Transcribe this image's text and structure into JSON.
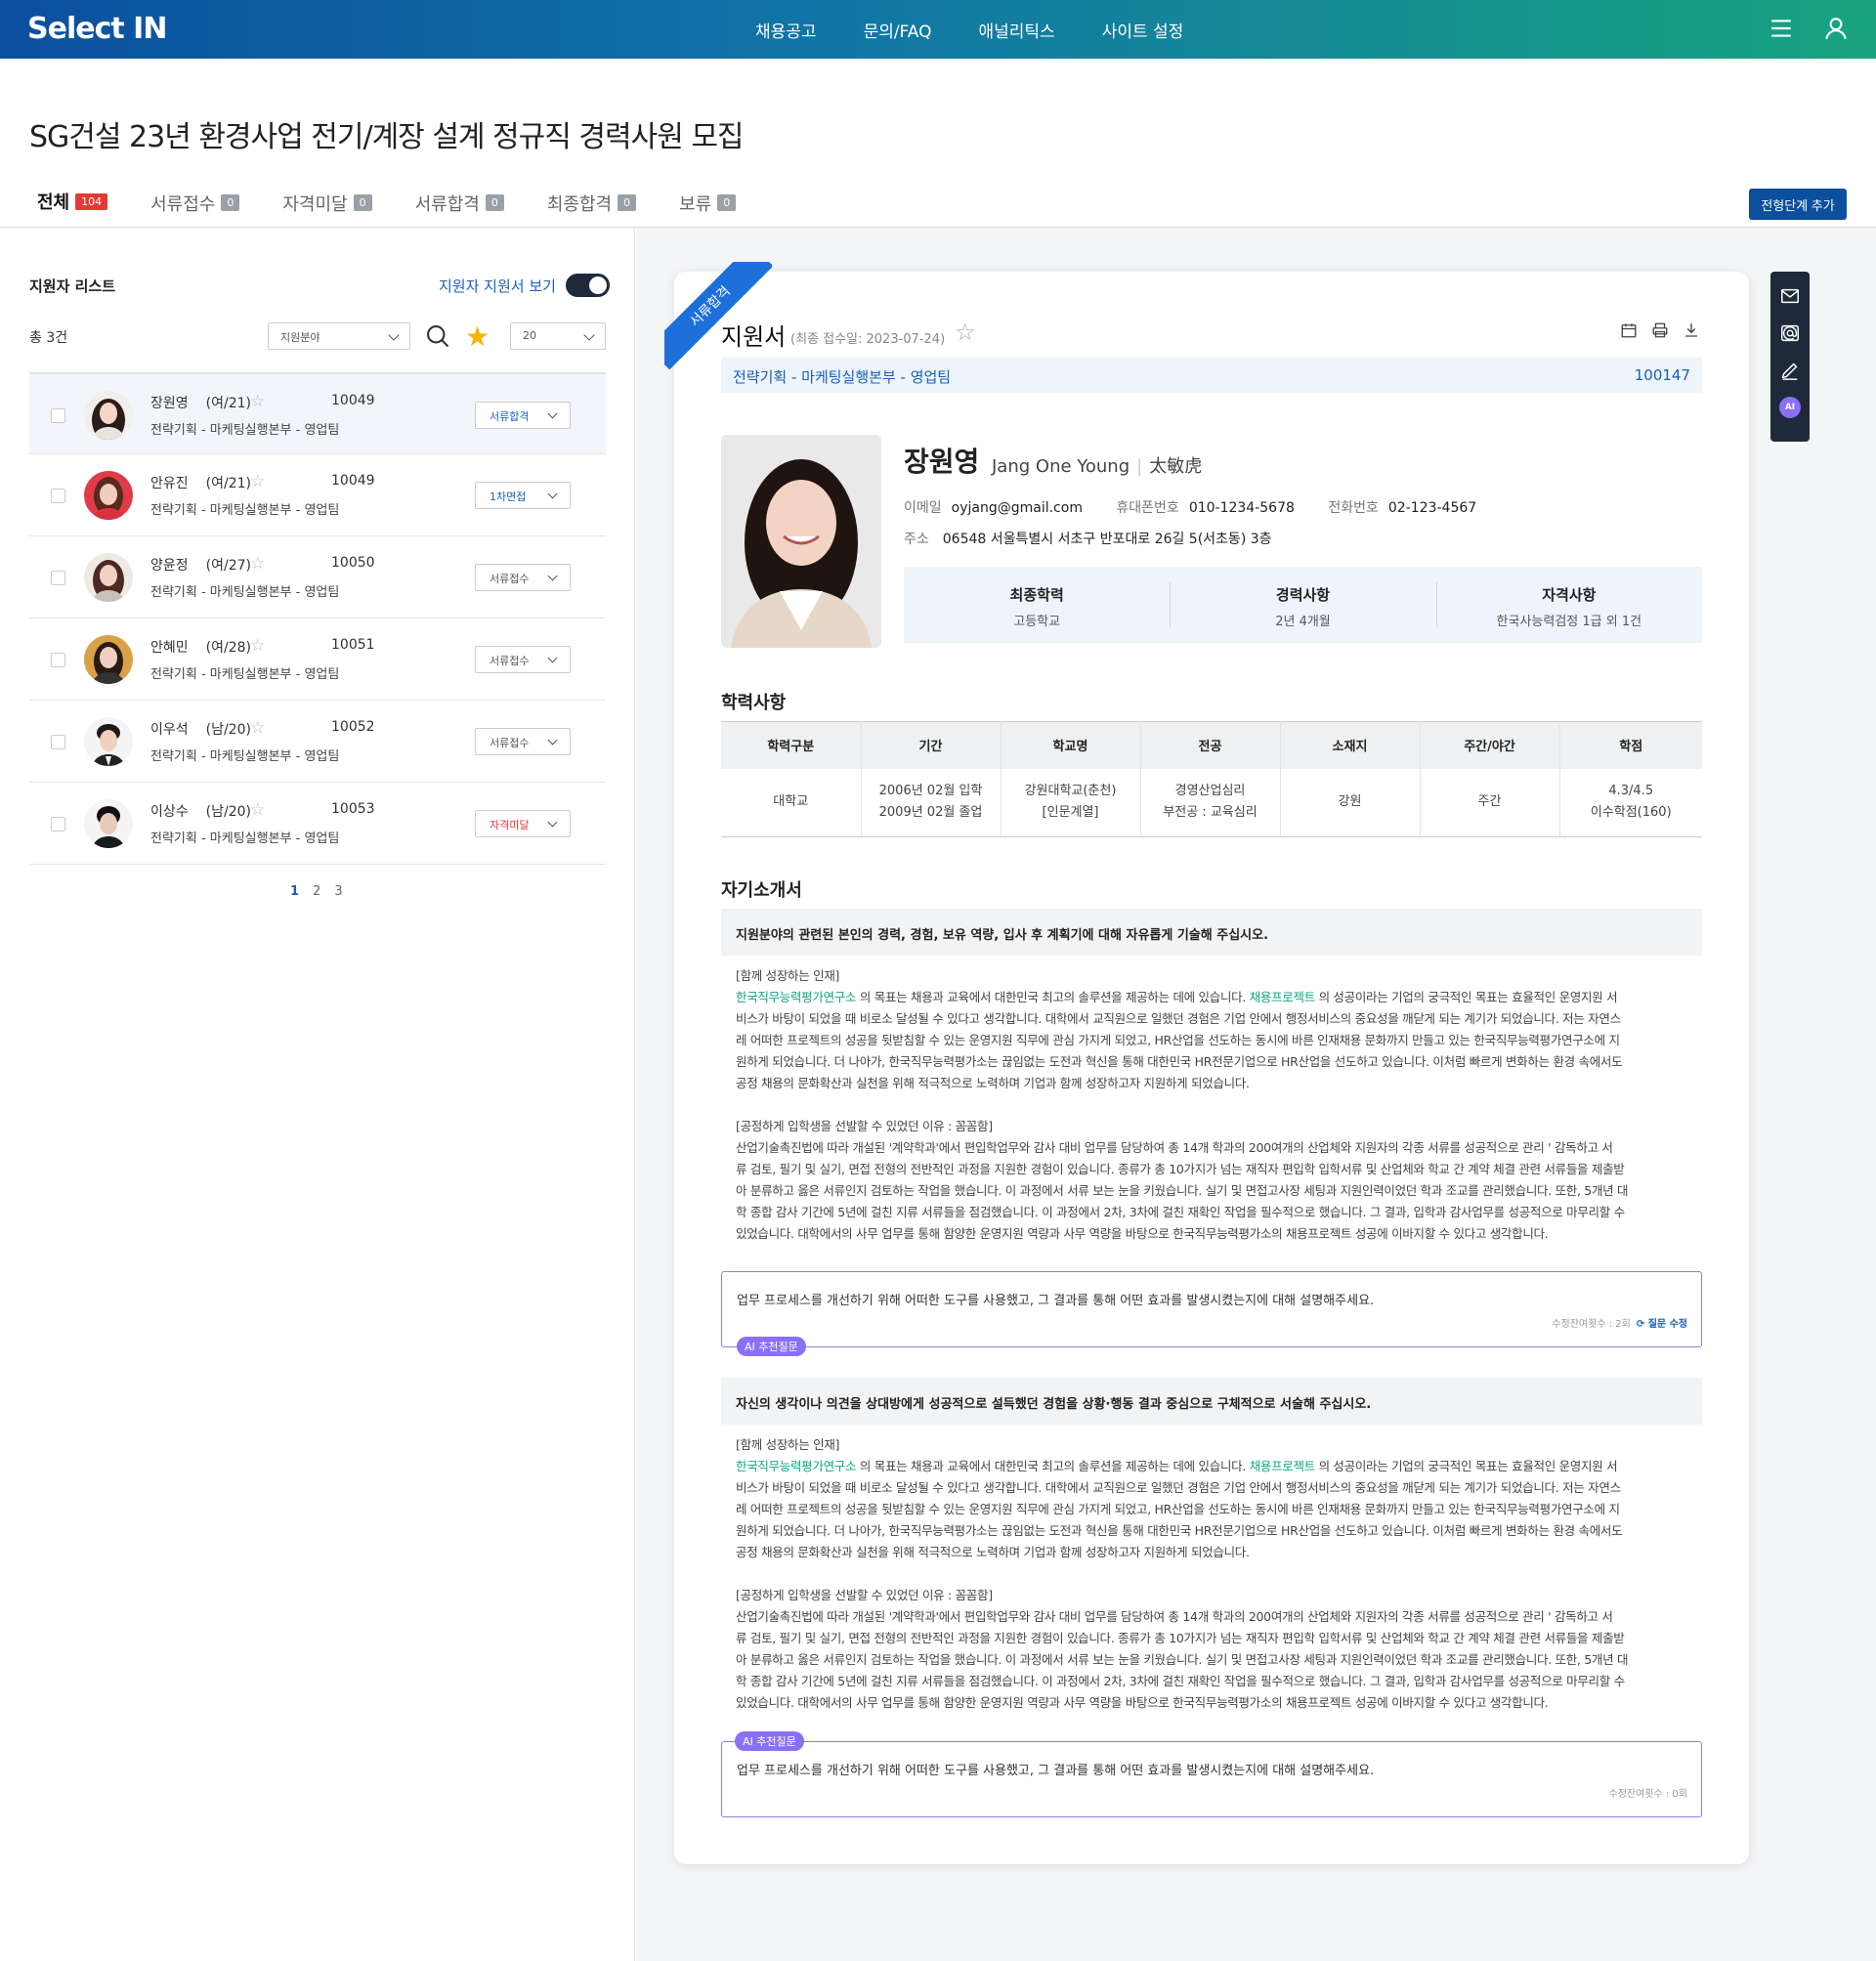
{
  "header": {
    "logo": "Select IN",
    "nav": [
      "채용공고",
      "문의/FAQ",
      "애널리틱스",
      "사이트 설정"
    ],
    "menu_icon": "menu-icon",
    "user_icon": "user-icon"
  },
  "page": {
    "title": "SG건설 23년 환경사업 전기/계장 설계 정규직 경력사원 모집",
    "add_step_button": "전형단계 추가"
  },
  "tabs": [
    {
      "label": "전체",
      "count": "104"
    },
    {
      "label": "서류접수",
      "count": "0"
    },
    {
      "label": "자격미달",
      "count": "0"
    },
    {
      "label": "서류합격",
      "count": "0"
    },
    {
      "label": "최종합격",
      "count": "0"
    },
    {
      "label": "보류",
      "count": "0"
    }
  ],
  "applicant_list": {
    "heading": "지원자 리스트",
    "toggle_label": "지원자 지원서 보기",
    "total": "총 3건",
    "field_select": "지원분야",
    "page_size": "20",
    "rows": [
      {
        "name": "장원영",
        "age": "(여/21)",
        "no": "10049",
        "dept": "전략기획 - 마케팅실행본부 - 영업팀",
        "status": "서류합격"
      },
      {
        "name": "안유진",
        "age": "(여/21)",
        "no": "10049",
        "dept": "전략기획 - 마케팅실행본부 - 영업팀",
        "status": "1차면접"
      },
      {
        "name": "양윤정",
        "age": "(여/27)",
        "no": "10050",
        "dept": "전략기획 - 마케팅실행본부 - 영업팀",
        "status": "서류접수"
      },
      {
        "name": "안혜민",
        "age": "(여/28)",
        "no": "10051",
        "dept": "전략기획 - 마케팅실행본부 - 영업팀",
        "status": "서류접수"
      },
      {
        "name": "이우석",
        "age": "(남/20)",
        "no": "10052",
        "dept": "전략기획 - 마케팅실행본부 - 영업팀",
        "status": "서류접수"
      },
      {
        "name": "이상수",
        "age": "(남/20)",
        "no": "10053",
        "dept": "전략기획 - 마케팅실행본부 - 영업팀",
        "status": "자격미달"
      }
    ],
    "pages": [
      "1",
      "2",
      "3"
    ]
  },
  "application": {
    "ribbon": "서류합격",
    "title": "지원서",
    "date": "(최종 접수일: 2023-07-24)",
    "dept": "전략기획 - 마케팅실행본부 - 영업팀",
    "app_no": "100147",
    "name": "장원영",
    "eng_name": "Jang One Young",
    "hanja_name": "太敏虎",
    "email_label": "이메일",
    "email": "oyjang@gmail.com",
    "mobile_label": "휴대폰번호",
    "mobile": "010-1234-5678",
    "phone_label": "전화번호",
    "phone": "02-123-4567",
    "addr_label": "주소",
    "addr": "06548 서울특별시 서초구 반포대로 26길 5(서초동) 3층",
    "summary": [
      {
        "h": "최종학력",
        "v": "고등학교"
      },
      {
        "h": "경력사항",
        "v": "2년 4개월"
      },
      {
        "h": "자격사항",
        "v": "한국사능력검정 1급 외 1건"
      }
    ],
    "education_title": "학력사항",
    "education_headers": [
      "학력구분",
      "기간",
      "학교명",
      "전공",
      "소재지",
      "주간/야간",
      "학점"
    ],
    "education_row": {
      "type": "대학교",
      "period1": "2006년 02월 입학",
      "period2": "2009년 02월 졸업",
      "school1": "강원대학교(춘천)",
      "school2": "[인문계열]",
      "major1": "경영산업심리",
      "major2": "부전공 : 교육심리",
      "location": "강원",
      "daynight": "주간",
      "gpa1": "4.3/4.5",
      "gpa2": "이수학점(160)"
    },
    "intro_title": "자기소개서",
    "q1": "지원분야의 관련된 본인의 경력, 경험, 보유 역량, 입사 후 계획기에 대해 자유롭게 기술해 주십시오.",
    "q2": "자신의 생각이나 의견을 상대방에게 성공적으로 설득했던 경험을 상황·행동 결과 중심으로 구체적으로 서술해 주십시오.",
    "essay": {
      "h1": "[함께 성장하는 인재]",
      "hl1": "한국직무능력평가연구소",
      "t1a": " 의 목표는 채용과 교육에서 대한민국 최고의 솔루션을 제공하는 데에 있습니다. ",
      "hl2": "채용프로젝트",
      "t1b": " 의 성공이라는 기업의 궁극적인 목표는 효율적인 운영지원 서",
      "l2": "비스가 바탕이 되었을 때 비로소 달성될 수 있다고 생각합니다. 대학에서 교직원으로 일했던 경험은 기업 안에서 행정서비스의 중요성을 깨닫게 되는 계기가 되었습니다. 저는 자연스",
      "l3": "레 어떠한 프로젝트의 성공을 뒷받침할 수 있는 운영지원 직무에 관심 가지게 되었고, HR산업을 선도하는 동시에 바른 인재채용 문화까지 만들고 있는 한국직무능력평가연구소에 지",
      "l4": "원하게 되었습니다. 더 나아가, 한국직무능력평가소는 끊임없는 도전과 혁신을 통해 대한민국 HR전문기업으로 HR산업을 선도하고 있습니다. 이처럼 빠르게 변화하는 환경 속에서도",
      "l5": "공정 채용의 문화확산과 실천을 위해 적극적으로 노력하며 기업과 함께 성장하고자 지원하게 되었습니다.",
      "h2": "[공정하게 입학생을 선발할 수 있었던 이유 : 꼼꼼함]",
      "m1": "  산업기술촉진법에 따라 개설된 '계약학과'에서 편입학업무와 감사 대비 업무를 담당하여 총 14개 학과의 200여개의 산업체와 지원자의 각종 서류를 성공적으로 관리 ' 감독하고 서",
      "m2": "류 검토, 필기 및 실기, 면접 전형의 전반적인 과정을 지원한 경험이 있습니다. 종류가 총 10가지가 넘는 재직자 편입학 입학서류 및 산업체와 학교 간 계약 체결 관련 서류들을 제출받",
      "m3": "아 분류하고 옳은 서류인지 검토하는 작업을 했습니다. 이 과정에서 서류 보는 눈을 키웠습니다. 실기 및 면접고사장 세팅과 지원인력이었던 학과 조교를 관리했습니다. 또한, 5개년 대",
      "m4": "학 종합 감사 기간에 5년에 걸친 지류 서류들을 점검했습니다. 이 과정에서 2차, 3차에 걸친 재확인 작업을 필수적으로 했습니다. 그 결과, 입학과 감사업무를 성공적으로 마무리할 수",
      "m5": "있었습니다. 대학에서의 사무 업무를 통해 함양한 운영지원 역량과 사무 역량을 바탕으로 한국직무능력평가소의 채용프로젝트 성공에 이바지할 수 있다고 생각합니다."
    },
    "ai_tag": "AI 추천질문",
    "ai_question": "업무 프로세스를 개선하기 위해 어떠한 도구를 사용했고, 그 결과를 통해 어떤 효과를 발생시켰는지에 대해 설명해주세요.",
    "ai_meta1": "수정잔여횟수 : 2회",
    "ai_edit": "질문 수정",
    "ai_meta2": "수정잔여횟수 : 0회"
  },
  "colors": {
    "accent": "#0b4f9e",
    "green": "#13a37f",
    "ai": "#8b6ff5",
    "danger": "#e53935"
  }
}
